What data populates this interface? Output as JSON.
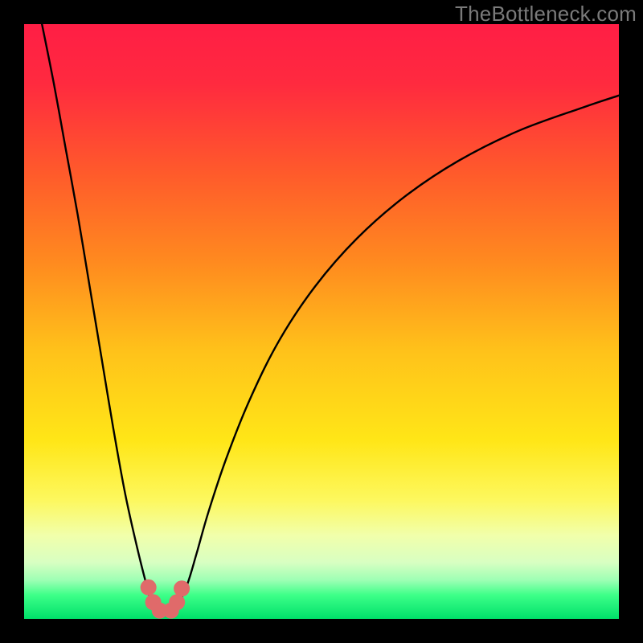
{
  "watermark": "TheBottleneck.com",
  "chart_data": {
    "type": "line",
    "title": "",
    "xlabel": "",
    "ylabel": "",
    "xlim": [
      0,
      100
    ],
    "ylim": [
      0,
      100
    ],
    "legend": false,
    "grid": false,
    "background_gradient_stops": [
      {
        "offset": 0.0,
        "color": "#ff1e45"
      },
      {
        "offset": 0.1,
        "color": "#ff2a3f"
      },
      {
        "offset": 0.25,
        "color": "#ff5a2b"
      },
      {
        "offset": 0.4,
        "color": "#ff8a1f"
      },
      {
        "offset": 0.55,
        "color": "#ffc21a"
      },
      {
        "offset": 0.7,
        "color": "#ffe617"
      },
      {
        "offset": 0.8,
        "color": "#fdf85e"
      },
      {
        "offset": 0.86,
        "color": "#f1ffab"
      },
      {
        "offset": 0.905,
        "color": "#d8ffc2"
      },
      {
        "offset": 0.935,
        "color": "#9dffb4"
      },
      {
        "offset": 0.96,
        "color": "#3dff88"
      },
      {
        "offset": 1.0,
        "color": "#00e06a"
      }
    ],
    "series": [
      {
        "name": "left-branch",
        "x": [
          3,
          5,
          7,
          9,
          11,
          13,
          15,
          17,
          19,
          20.5,
          21.5,
          22.5
        ],
        "y": [
          100,
          90,
          79,
          68,
          56,
          44,
          32,
          21,
          12,
          6,
          2.5,
          0.8
        ]
      },
      {
        "name": "right-branch",
        "x": [
          25,
          26,
          27.5,
          29,
          31,
          34,
          38,
          43,
          49,
          56,
          64,
          73,
          83,
          94,
          100
        ],
        "y": [
          0.8,
          2.5,
          6,
          11,
          18,
          27,
          37,
          47,
          56,
          64,
          71,
          77,
          82,
          86,
          88
        ]
      }
    ],
    "markers": {
      "name": "bottom-cluster",
      "color": "#e06a6a",
      "radius_px": 10,
      "points": [
        {
          "x": 20.9,
          "y": 5.3
        },
        {
          "x": 21.7,
          "y": 2.8
        },
        {
          "x": 22.8,
          "y": 1.4
        },
        {
          "x": 24.7,
          "y": 1.4
        },
        {
          "x": 25.7,
          "y": 2.8
        },
        {
          "x": 26.5,
          "y": 5.1
        }
      ]
    }
  }
}
